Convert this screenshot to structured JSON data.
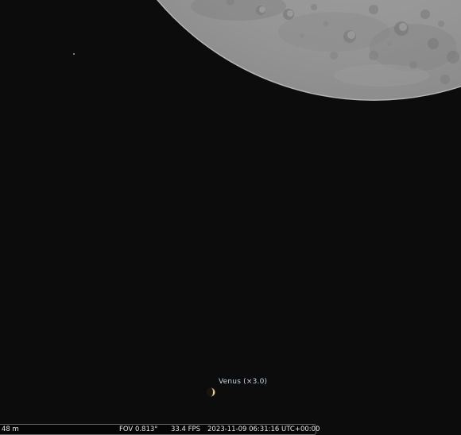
{
  "sky": {
    "background_color": "#0c0c0c"
  },
  "moon": {
    "icon": "moon-icon",
    "surface_color": "#9b9b9b"
  },
  "venus": {
    "icon": "venus-crescent-icon",
    "label": "Venus (×3.0)"
  },
  "status_bar": {
    "altitude": "48 m",
    "fov": "FOV 0.813°",
    "fps": "33.4 FPS",
    "datetime": "2023-11-09 06:31:16 UTC+00:00"
  }
}
